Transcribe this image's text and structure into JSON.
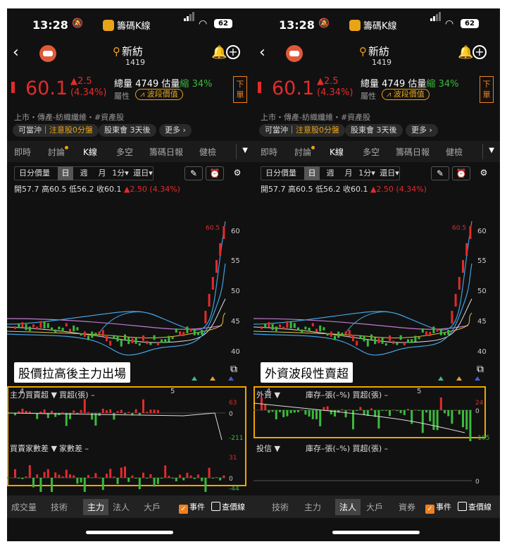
{
  "status": {
    "time": "13:28",
    "app": "籌碼K線",
    "battery": "62"
  },
  "stock": {
    "name": "新紡",
    "code": "1419",
    "price": "60.1",
    "change": "▲2.5",
    "change_pct": "(4.34%)",
    "volume_label": "總量",
    "volume": "4749",
    "est_label": "估量",
    "est_dir": "縮",
    "est_pct": "34%",
    "attr": "屬性",
    "wave": "波段價值",
    "order": "下單",
    "tags": "上市・傳產-紡織纖維・#資產股"
  },
  "pills": [
    "可當沖｜注意股0分盤",
    "股東會 3天後",
    "更多 ›"
  ],
  "pill_caution": "注意股0分盤",
  "tabs": [
    "即時",
    "討論",
    "K線",
    "多空",
    "籌碼日報",
    "健檢"
  ],
  "periods": [
    "日分價量",
    "日",
    "週",
    "月",
    "1分▾",
    "還日▾"
  ],
  "ohlc": {
    "text": "開57.7 高60.5 低56.2 收60.1",
    "chg": "▲2.50 (4.34%)"
  },
  "price_axis": [
    "60",
    "55",
    "50",
    "45",
    "40"
  ],
  "high_label": "60.5",
  "x_labels": [
    "4",
    "5"
  ],
  "panels": [
    {
      "annotation": "股價拉高後主力出場",
      "sub1": {
        "select": "主力買賣超",
        "meta": "買超(張) –",
        "top": "63",
        "mid": "0",
        "bot": "-211"
      },
      "sub2": {
        "select": "買賣家數差",
        "meta": "家數差 –",
        "top": "31",
        "mid": "0",
        "bot": "-44"
      },
      "bottom_tabs": [
        "成交量",
        "技術",
        "主力",
        "法人",
        "大戶"
      ],
      "active": "主力"
    },
    {
      "annotation": "外資波段性賣超",
      "sub1": {
        "select": "外資",
        "meta": "庫存–張(–%)  買超(張) –",
        "top": "24",
        "mid": "0",
        "bot": "-105"
      },
      "sub2": {
        "select": "投信",
        "meta": "庫存–張(–%)  買超(張) –",
        "top": "",
        "mid": "0",
        "bot": ""
      },
      "bottom_tabs": [
        "技術",
        "主力",
        "法人",
        "大戶",
        "資券"
      ],
      "active": "法人"
    }
  ],
  "checks": {
    "event": "事件",
    "price_line": "查價線"
  }
}
